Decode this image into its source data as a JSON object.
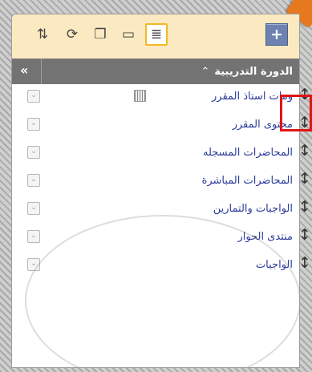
{
  "toolbar": {
    "buttons": [
      {
        "name": "reorder-icon",
        "glyph": "⇅"
      },
      {
        "name": "refresh-icon",
        "glyph": "⟳"
      },
      {
        "name": "window-icon",
        "glyph": "❐"
      },
      {
        "name": "folder-icon",
        "glyph": "▭"
      },
      {
        "name": "list-icon",
        "glyph": "≣"
      }
    ],
    "add_glyph": "+"
  },
  "header": {
    "title": "الدورة التدريبية",
    "collapse_glyph": "«",
    "up_glyph": "⌃"
  },
  "nav": {
    "items": [
      {
        "label": "ومات استاذ المقرر"
      },
      {
        "label": "محتوى المقرر"
      },
      {
        "label": "المحاضرات المسجله"
      },
      {
        "label": "المحاضرات المباشرة"
      },
      {
        "label": "الواجبات والتمارين"
      },
      {
        "label": "منتدى الحوار"
      },
      {
        "label": "الواجبات"
      }
    ],
    "chevron_glyph": "⌄",
    "handle_glyph": "↕"
  },
  "colors": {
    "toolbar_bg": "#fbe9c2",
    "header_bg": "#737373",
    "link": "#2b3b9a",
    "highlight": "#e01414",
    "accent": "#e6781e"
  }
}
